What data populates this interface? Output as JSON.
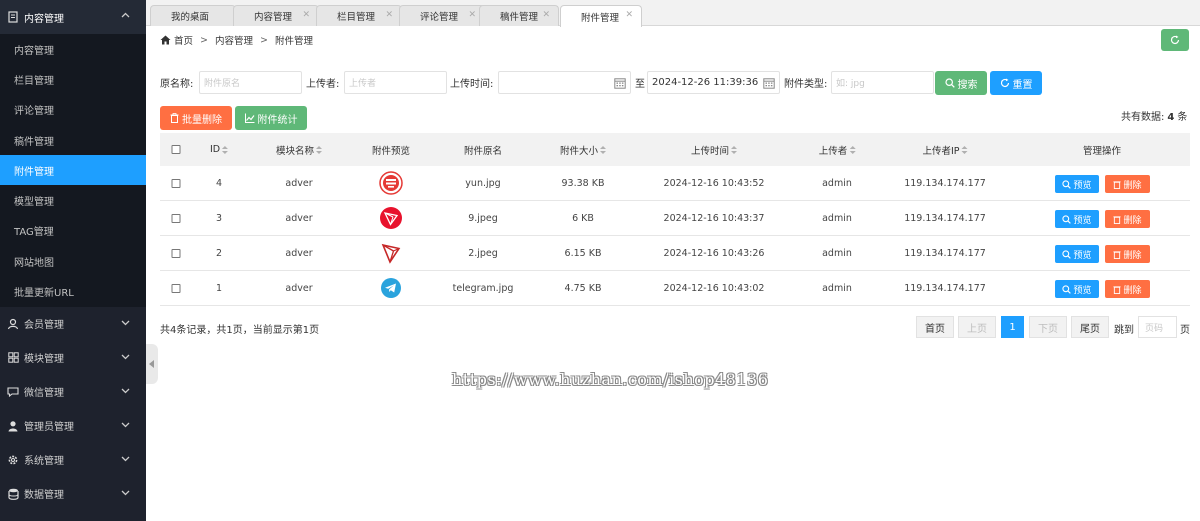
{
  "sidebar": {
    "groups": [
      {
        "label": "内容管理",
        "icon": "document-icon"
      },
      {
        "label": "会员管理",
        "icon": "user-icon"
      },
      {
        "label": "模块管理",
        "icon": "grid-icon"
      },
      {
        "label": "微信管理",
        "icon": "chat-icon"
      },
      {
        "label": "管理员管理",
        "icon": "admin-icon"
      },
      {
        "label": "系统管理",
        "icon": "gear-icon"
      },
      {
        "label": "数据管理",
        "icon": "database-icon"
      }
    ],
    "subitems": [
      "内容管理",
      "栏目管理",
      "评论管理",
      "稿件管理",
      "附件管理",
      "模型管理",
      "TAG管理",
      "网站地图",
      "批量更新URL"
    ],
    "active_subitem": "附件管理"
  },
  "tabs": [
    "我的桌面",
    "内容管理",
    "栏目管理",
    "评论管理",
    "稿件管理",
    "附件管理"
  ],
  "breadcrumb": {
    "home": "首页",
    "level1": "内容管理",
    "level2": "附件管理"
  },
  "search": {
    "name_label": "原名称:",
    "name_placeholder": "附件原名",
    "uploader_label": "上传者:",
    "uploader_placeholder": "上传者",
    "time_label": "上传时间:",
    "time_start": "",
    "to_label": "至",
    "time_end": "2024-12-26 11:39:36",
    "type_label": "附件类型:",
    "type_placeholder": "如: jpg",
    "search_btn": "搜索",
    "reset_btn": "重置"
  },
  "toolbar": {
    "batch_delete": "批量删除",
    "stats": "附件统计"
  },
  "total": {
    "prefix": "共有数据:",
    "count": "4",
    "suffix": "条"
  },
  "table": {
    "headers": [
      "ID",
      "模块名称",
      "附件预览",
      "附件原名",
      "附件大小",
      "上传时间",
      "上传者",
      "上传者IP",
      "管理操作"
    ],
    "rows": [
      {
        "id": "4",
        "module": "adver",
        "preview": "red-circle-logo",
        "name": "yun.jpg",
        "size": "93.38 KB",
        "time": "2024-12-16 10:43:52",
        "uploader": "admin",
        "ip": "119.134.174.177"
      },
      {
        "id": "3",
        "module": "adver",
        "preview": "tron-red-icon",
        "name": "9.jpeg",
        "size": "6 KB",
        "time": "2024-12-16 10:43:37",
        "uploader": "admin",
        "ip": "119.134.174.177"
      },
      {
        "id": "2",
        "module": "adver",
        "preview": "tron-outline-icon",
        "name": "2.jpeg",
        "size": "6.15 KB",
        "time": "2024-12-16 10:43:26",
        "uploader": "admin",
        "ip": "119.134.174.177"
      },
      {
        "id": "1",
        "module": "adver",
        "preview": "telegram-icon",
        "name": "telegram.jpg",
        "size": "4.75 KB",
        "time": "2024-12-16 10:43:02",
        "uploader": "admin",
        "ip": "119.134.174.177"
      }
    ],
    "preview_btn": "预览",
    "delete_btn": "删除"
  },
  "footer": {
    "summary": "共4条记录，共1页，当前显示第1页"
  },
  "pagination": {
    "first": "首页",
    "prev": "上页",
    "current": "1",
    "next": "下页",
    "last": "尾页",
    "jump_label": "跳到",
    "jump_placeholder": "页码",
    "page_suffix": "页"
  },
  "watermark": "https://www.huzhan.com/ishop48136",
  "colors": {
    "sidebar_bg": "#1e222d",
    "active_blue": "#1e9fff",
    "green": "#5fb878",
    "red": "#ff5722"
  }
}
